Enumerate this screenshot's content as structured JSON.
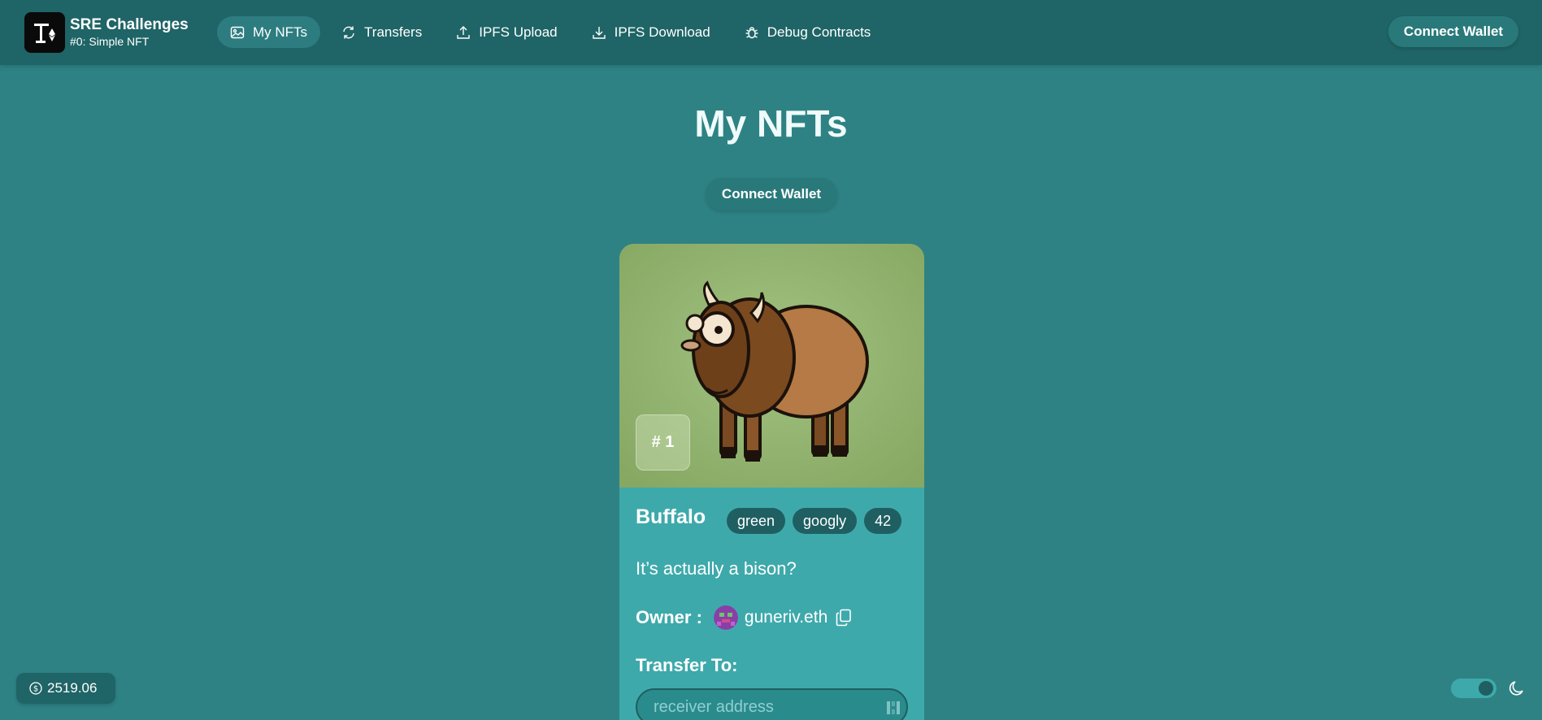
{
  "brand": {
    "title": "SRE Challenges",
    "subtitle": "#0: Simple NFT"
  },
  "nav": {
    "items": [
      {
        "label": "My NFTs",
        "icon": "image-icon",
        "active": true
      },
      {
        "label": "Transfers",
        "icon": "refresh-icon",
        "active": false
      },
      {
        "label": "IPFS Upload",
        "icon": "upload-icon",
        "active": false
      },
      {
        "label": "IPFS Download",
        "icon": "download-icon",
        "active": false
      },
      {
        "label": "Debug Contracts",
        "icon": "bug-icon",
        "active": false
      }
    ]
  },
  "header": {
    "connect_label": "Connect Wallet"
  },
  "main": {
    "title": "My NFTs",
    "connect_label": "Connect Wallet"
  },
  "nft": {
    "token_id": "# 1",
    "name": "Buffalo",
    "tags": [
      "green",
      "googly",
      "42"
    ],
    "description": "It’s actually a bison?",
    "owner_label": "Owner :",
    "owner_name": "guneriv.eth",
    "transfer_label": "Transfer To:",
    "receiver_placeholder": "receiver address"
  },
  "footer": {
    "balance": "2519.06"
  },
  "colors": {
    "background": "#2e8284",
    "header": "#1f6466",
    "card": "#3ea9ab",
    "tag": "#1f5f62"
  }
}
